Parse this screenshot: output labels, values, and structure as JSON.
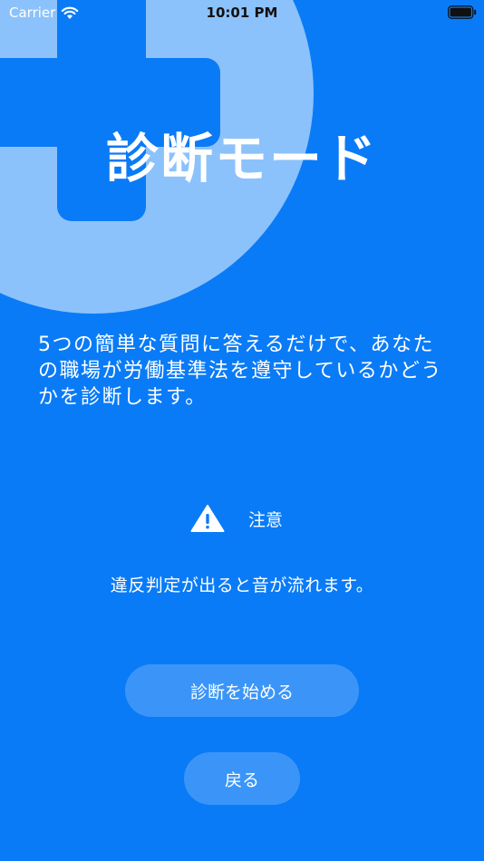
{
  "status_bar": {
    "carrier": "Carrier",
    "time": "10:01 PM"
  },
  "icons": {
    "wifi": "wifi-icon",
    "battery": "battery-icon",
    "warning": "warning-icon",
    "background": "medical-cross-icon"
  },
  "colors": {
    "background": "#0a7bf7",
    "circle": "#8cc2fb",
    "button": "#3b95f8"
  },
  "main": {
    "title": "診断モード",
    "description": "5つの簡単な質問に答えるだけで、あなたの職場が労働基準法を遵守しているかどうかを診断します。",
    "caution_label": "注意",
    "warning_text": "違反判定が出ると音が流れます。"
  },
  "buttons": {
    "start": "診断を始める",
    "back": "戻る"
  }
}
